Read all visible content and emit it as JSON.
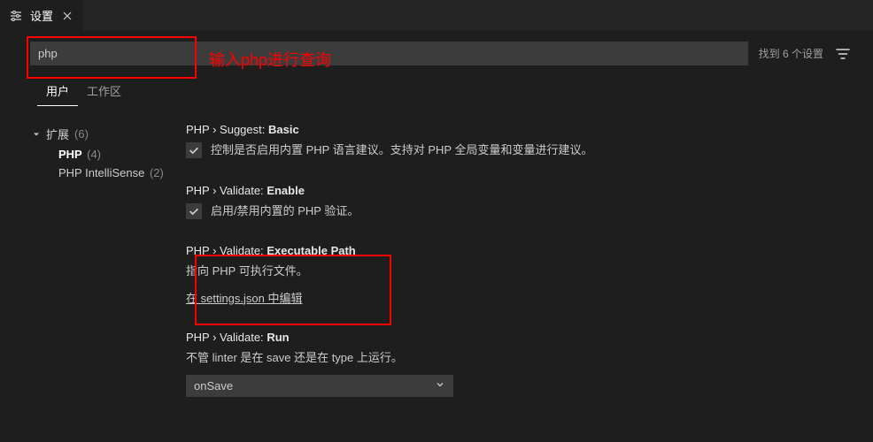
{
  "tab": {
    "title": "设置"
  },
  "search": {
    "value": "php",
    "count_text": "找到 6 个设置"
  },
  "annotations": {
    "search_hint": "输入php进行查询"
  },
  "scope_tabs": {
    "user": "用户",
    "workspace": "工作区"
  },
  "sidebar": {
    "extensions_label": "扩展",
    "extensions_count": "(6)",
    "items": [
      {
        "label": "PHP",
        "count": "(4)"
      },
      {
        "label": "PHP IntelliSense",
        "count": "(2)"
      }
    ]
  },
  "settings": [
    {
      "cat": "PHP › Suggest:",
      "name": "Basic",
      "type": "checkbox",
      "checked": true,
      "desc": "控制是否启用内置 PHP 语言建议。支持对 PHP 全局变量和变量进行建议。"
    },
    {
      "cat": "PHP › Validate:",
      "name": "Enable",
      "type": "checkbox",
      "checked": true,
      "desc": "启用/禁用内置的 PHP 验证。"
    },
    {
      "cat": "PHP › Validate:",
      "name": "Executable Path",
      "type": "link",
      "desc": "指向 PHP 可执行文件。",
      "link_text": "在 settings.json 中编辑"
    },
    {
      "cat": "PHP › Validate:",
      "name": "Run",
      "type": "select",
      "desc": "不管 linter 是在 save 还是在 type 上运行。",
      "value": "onSave"
    }
  ]
}
